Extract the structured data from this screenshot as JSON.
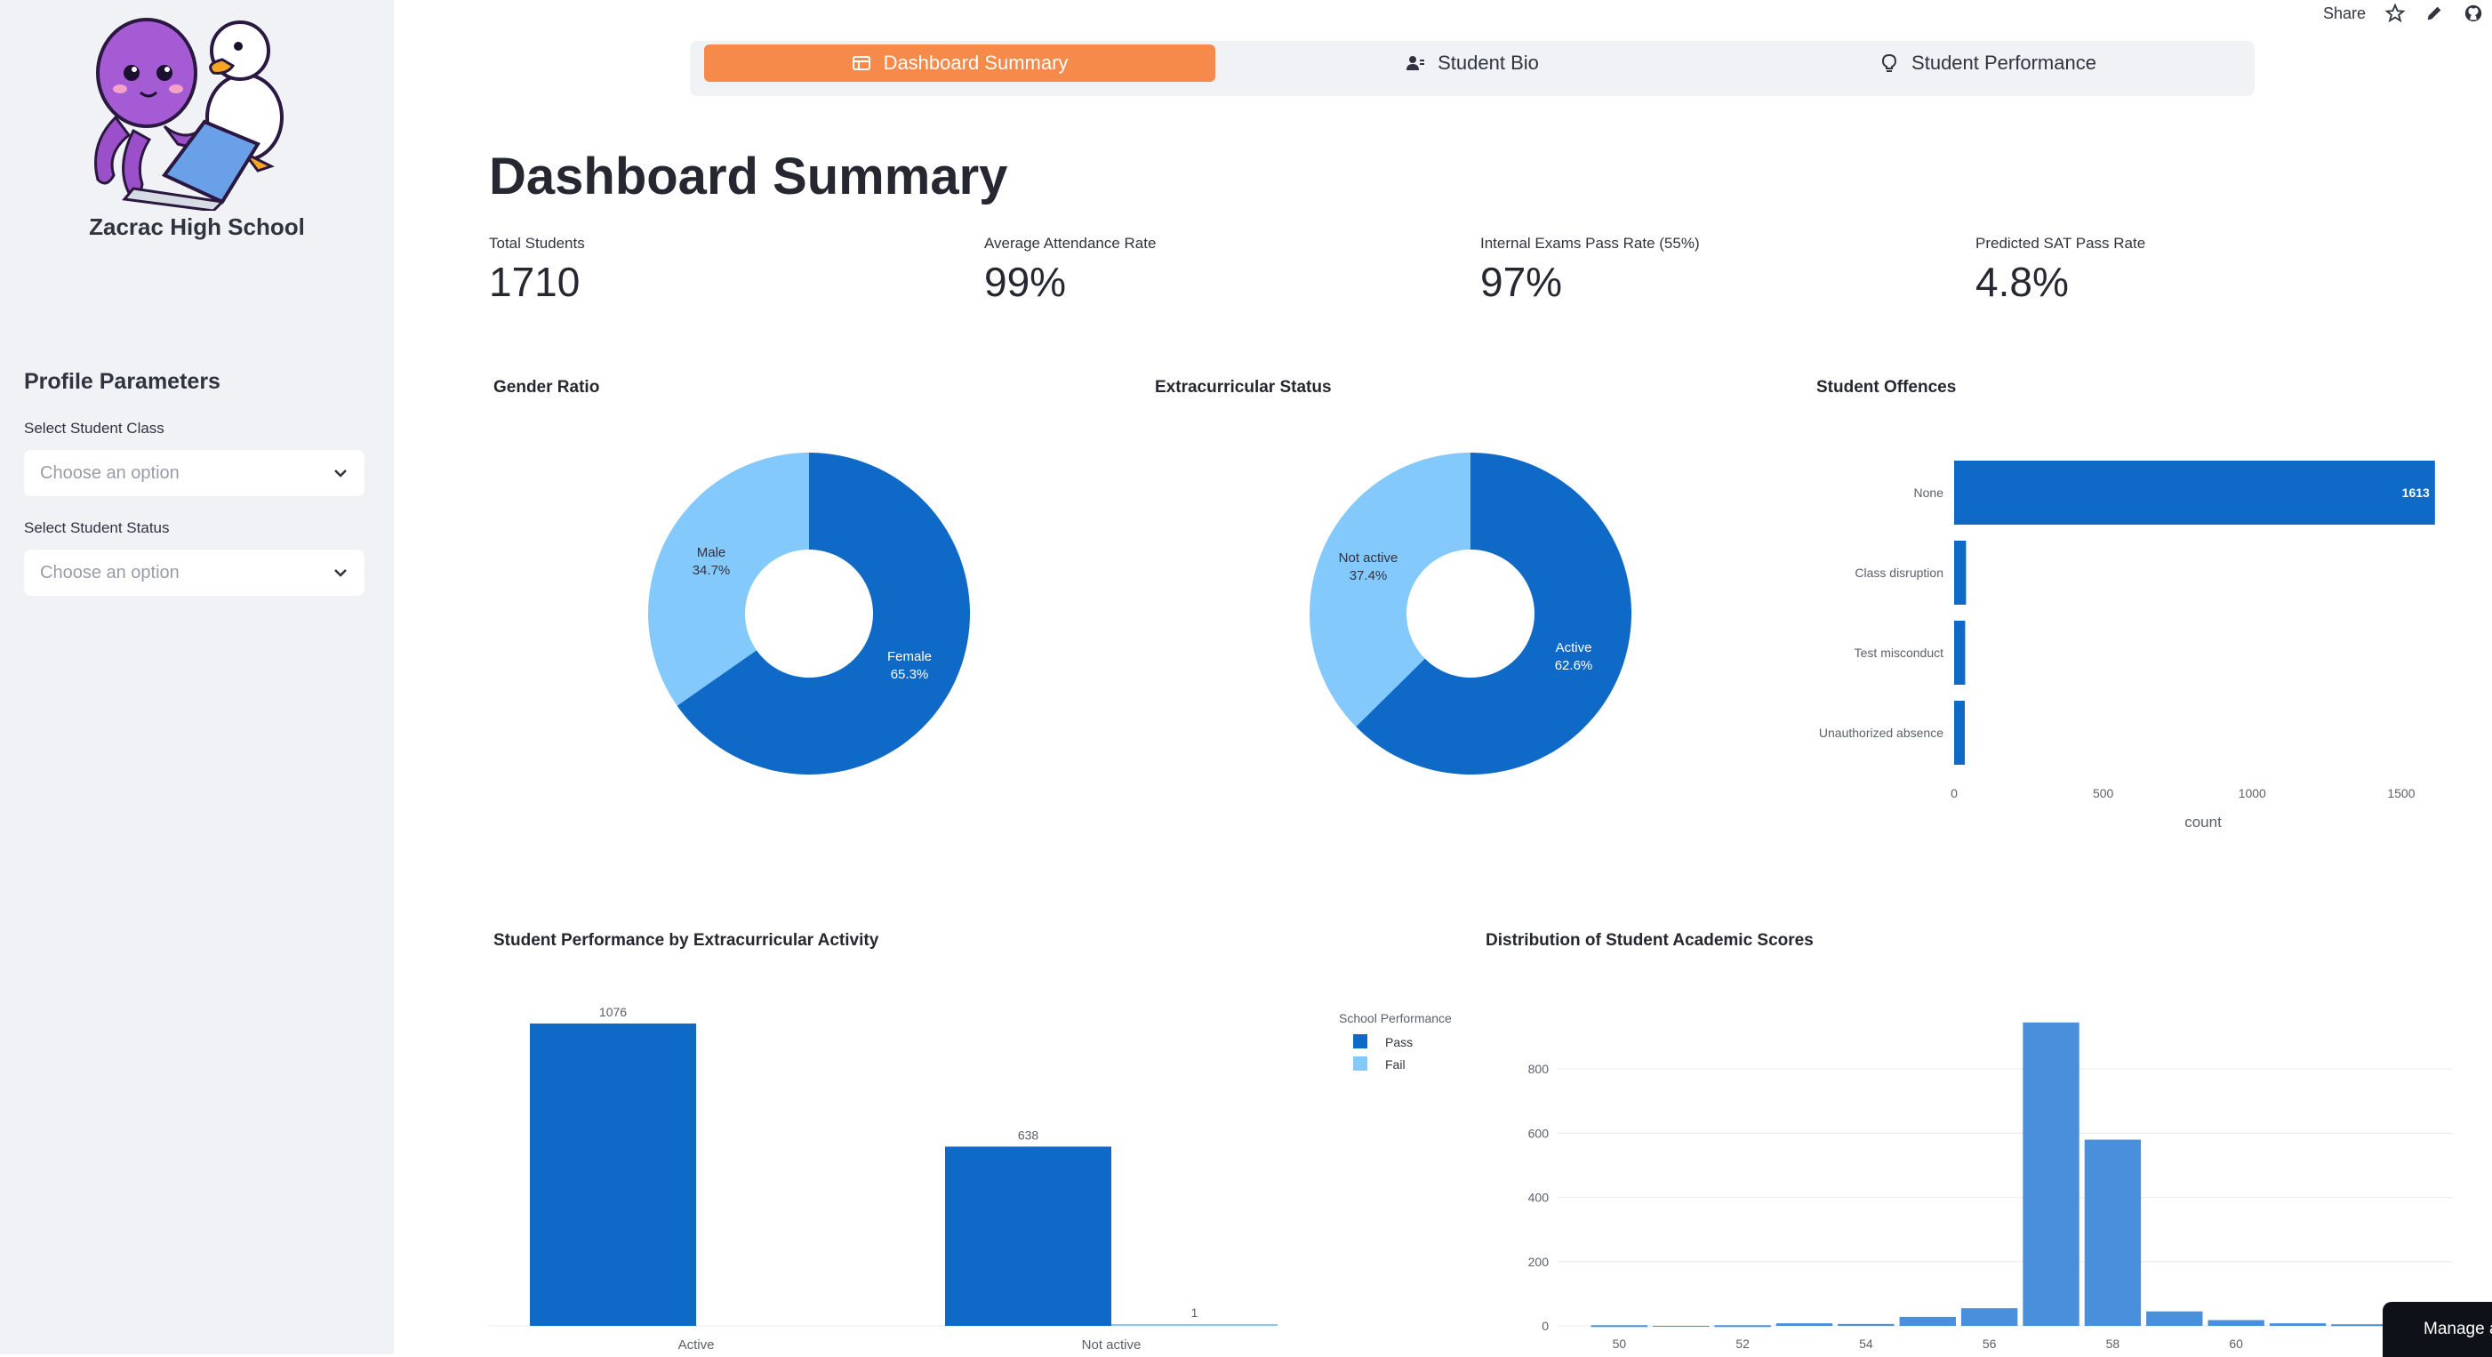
{
  "sidebar": {
    "school_name": "Zacrac High School",
    "heading": "Profile Parameters",
    "class_label": "Select Student Class",
    "class_placeholder": "Choose an option",
    "status_label": "Select Student Status",
    "status_placeholder": "Choose an option"
  },
  "toolbar": {
    "share_label": "Share"
  },
  "tabs": [
    {
      "label": "Dashboard Summary",
      "icon": "table-icon",
      "active": true
    },
    {
      "label": "Student Bio",
      "icon": "person-icon",
      "active": false
    },
    {
      "label": "Student Performance",
      "icon": "lightbulb-icon",
      "active": false
    }
  ],
  "page_title": "Dashboard Summary",
  "metrics": [
    {
      "label": "Total Students",
      "value": "1710"
    },
    {
      "label": "Average Attendance Rate",
      "value": "99%"
    },
    {
      "label": "Internal Exams Pass Rate (55%)",
      "value": "97%"
    },
    {
      "label": "Predicted SAT Pass Rate",
      "value": "4.8%"
    }
  ],
  "colors": {
    "accent": "#f58a4b",
    "dark_blue": "#0f69c7",
    "light_blue": "#83c9fb",
    "hist_blue": "#4a8fdb"
  },
  "chart_data": [
    {
      "type": "pie",
      "title": "Gender Ratio",
      "labels": [
        "Female",
        "Male"
      ],
      "values": [
        65.3,
        34.7
      ],
      "label_text": [
        "65.3%",
        "34.7%"
      ],
      "hole": true
    },
    {
      "type": "pie",
      "title": "Extracurricular Status",
      "labels": [
        "Active",
        "Not active"
      ],
      "values": [
        62.6,
        37.4
      ],
      "label_text": [
        "62.6%",
        "37.4%"
      ],
      "hole": true
    },
    {
      "type": "bar",
      "orientation": "horizontal",
      "title": "Student Offences",
      "categories": [
        "None",
        "Class disruption",
        "Test misconduct",
        "Unauthorized absence"
      ],
      "values": [
        1613,
        40,
        37,
        20
      ],
      "value_labels": [
        "1613",
        "",
        "",
        ""
      ],
      "xlabel": "count",
      "xticks": [
        "0",
        "500",
        "1000",
        "1500"
      ],
      "xlim": [
        0,
        1700
      ]
    },
    {
      "type": "bar",
      "title": "Student Performance by Extracurricular Activity",
      "categories": [
        "Active",
        "Not active"
      ],
      "legend_title": "School Performance",
      "series": [
        {
          "name": "Pass",
          "values": [
            1076,
            638
          ]
        },
        {
          "name": "Fail",
          "values": [
            0,
            1
          ]
        }
      ],
      "value_labels": [
        "1076",
        "638",
        "1"
      ],
      "ylim": [
        0,
        1076
      ]
    },
    {
      "type": "bar",
      "title": "Distribution of Student Academic Scores",
      "x": [
        49.5,
        50.5,
        51.5,
        52.5,
        53.5,
        54.5,
        55.5,
        56.5,
        57.5,
        58.5,
        59.5,
        60.5,
        61.5,
        62.5
      ],
      "values": [
        2,
        0,
        2,
        8,
        6,
        28,
        55,
        945,
        580,
        45,
        18,
        8,
        5,
        3
      ],
      "xticks": [
        "50",
        "52",
        "54",
        "56",
        "58",
        "60"
      ],
      "yticks": [
        "0",
        "200",
        "400",
        "600",
        "800"
      ],
      "ylim": [
        0,
        950
      ]
    }
  ],
  "manage_label": "Manage app"
}
